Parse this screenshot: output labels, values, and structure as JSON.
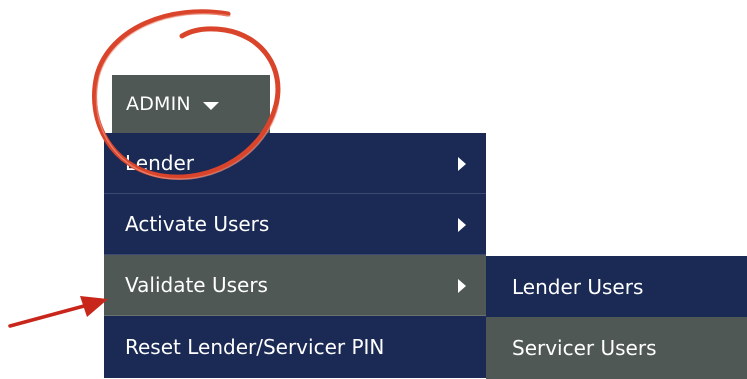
{
  "admin_menu": {
    "label": "ADMIN",
    "caret_icon": "caret-down-icon"
  },
  "menu": {
    "items": [
      {
        "label": "Lender",
        "submenu_icon": "chevron-right-icon"
      },
      {
        "label": "Activate Users",
        "submenu_icon": "chevron-right-icon"
      },
      {
        "label": "Validate Users",
        "submenu_icon": "chevron-right-icon",
        "active": true
      },
      {
        "label": "Reset Lender/Servicer PIN"
      }
    ]
  },
  "submenu": {
    "items": [
      {
        "label": "Lender Users"
      },
      {
        "label": "Servicer Users"
      }
    ]
  },
  "colors": {
    "menu_bg": "#1b2a55",
    "active_bg": "#4f5854",
    "annotation": "#d9442a"
  }
}
